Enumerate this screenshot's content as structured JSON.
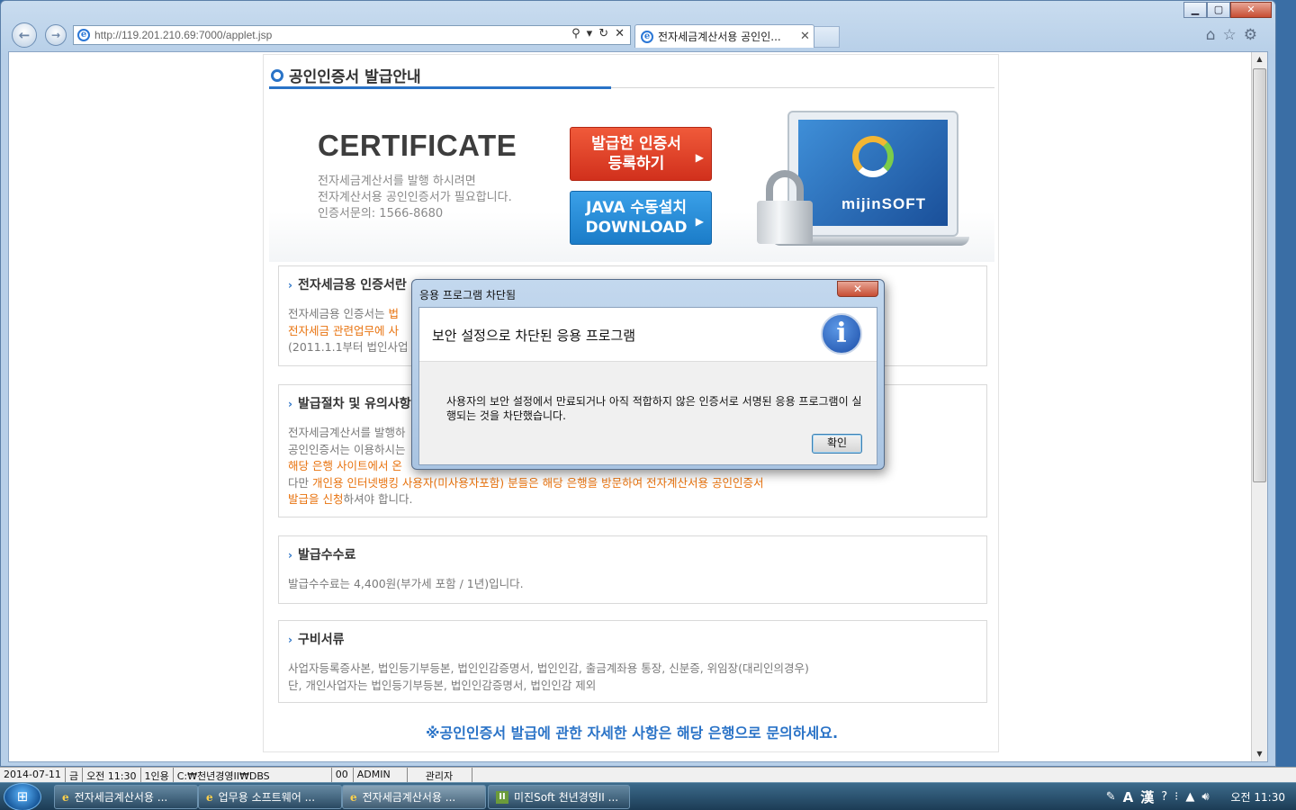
{
  "browser": {
    "url": "http://119.201.210.69:7000/applet.jsp",
    "tab_title": "전자세금계산서용 공인인...",
    "tab_close": "✕",
    "minimize": "▁",
    "maximize": "▢",
    "close": "✕"
  },
  "page": {
    "title": "공인인증서 발급안내",
    "hero": {
      "big_title": "CERTIFICATE",
      "desc1": "전자세금계산서를 발행 하시려면",
      "desc2": "전자계산서용 공인인증서가 필요합니다.",
      "desc3": "인증서문의: 1566-8680",
      "btn_register_1": "발급한 인증서",
      "btn_register_2": "등록하기",
      "btn_java_1": "JAVA 수동설치",
      "btn_java_2": "DOWNLOAD",
      "brand": "mijinSOFT"
    },
    "sections": {
      "s1": {
        "title": "전자세금용 인증서란",
        "l1a": "전자세금용 인증서는",
        "l1b": "법",
        "l2a": "전자세금 관련업무에 사",
        "l3": "(2011.1.1부터 법인사업"
      },
      "s2": {
        "title": "발급절차 및 유의사항",
        "l1": "전자세금계산서를 발행하",
        "l2": "공인인증서는 이용하시는",
        "l3": "해당 은행 사이트에서 온",
        "l4a": "다만 ",
        "l4b": "개인용 인터넷뱅킹 사용자(미사용자포함) 분들은 해당 은행을 방문하여 전자계산서용 공인인증서",
        "l5a": "발급을 신청",
        "l5b": "하셔야 합니다."
      },
      "s3": {
        "title": "발급수수료",
        "l1": "발급수수료는 4,400원(부가세 포함 / 1년)입니다."
      },
      "s4": {
        "title": "구비서류",
        "l1": "사업자등록증사본, 법인등기부등본, 법인인감증명서, 법인인감, 출금계좌용 통장, 신분증, 위임장(대리인의경우)",
        "l2": "단, 개인사업자는 법인등기부등본, 법인인감증명서, 법인인감 제외"
      }
    },
    "footer_note": "※공인인증서 발급에 관한 자세한 사항은 해당 은행으로 문의하세요."
  },
  "dialog": {
    "title": "응용 프로그램 차단됨",
    "heading": "보안 설정으로 차단된 응용 프로그램",
    "message": "사용자의 보안 설정에서 만료되거나 아직 적합하지 않은 인증서로 서명된 응용 프로그램이 실행되는 것을 차단했습니다.",
    "ok": "확인",
    "close": "✕"
  },
  "statusbar": {
    "date": "2014-07-11",
    "day": "금",
    "time": "오전 11:30",
    "users": "1인용",
    "path": "C:₩천년경영II₩DBS",
    "code": "00",
    "user": "ADMIN",
    "role": "관리자"
  },
  "taskbar": {
    "items": [
      "전자세금계산서용 ...",
      "업무용 소프트웨어 ...",
      "전자세금계산서용 ...",
      "미진Soft 천년경영II ..."
    ],
    "ime_a": "A",
    "ime_han": "漢",
    "clock": "오전 11:30"
  }
}
